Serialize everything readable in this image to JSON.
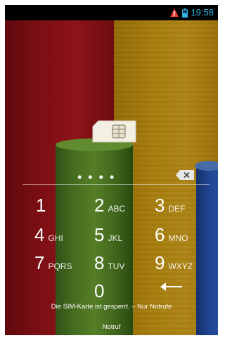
{
  "statusbar": {
    "time": "19:58",
    "icons": [
      "alert-icon",
      "battery-icon"
    ]
  },
  "lockscreen": {
    "pin_masked": "••••",
    "keys": [
      {
        "num": "1",
        "letters": ""
      },
      {
        "num": "2",
        "letters": "ABC"
      },
      {
        "num": "3",
        "letters": "DEF"
      },
      {
        "num": "4",
        "letters": "GHI"
      },
      {
        "num": "5",
        "letters": "JKL"
      },
      {
        "num": "6",
        "letters": "MNO"
      },
      {
        "num": "7",
        "letters": "PQRS"
      },
      {
        "num": "8",
        "letters": "TUV"
      },
      {
        "num": "9",
        "letters": "WXYZ"
      },
      {
        "num": "0",
        "letters": ""
      }
    ],
    "message": "Die SIM-Karte ist gesperrt. – Nur Notrufe",
    "emergency_label": "Notruf"
  },
  "colors": {
    "clock": "#33b5e5",
    "alert": "#e53935"
  }
}
